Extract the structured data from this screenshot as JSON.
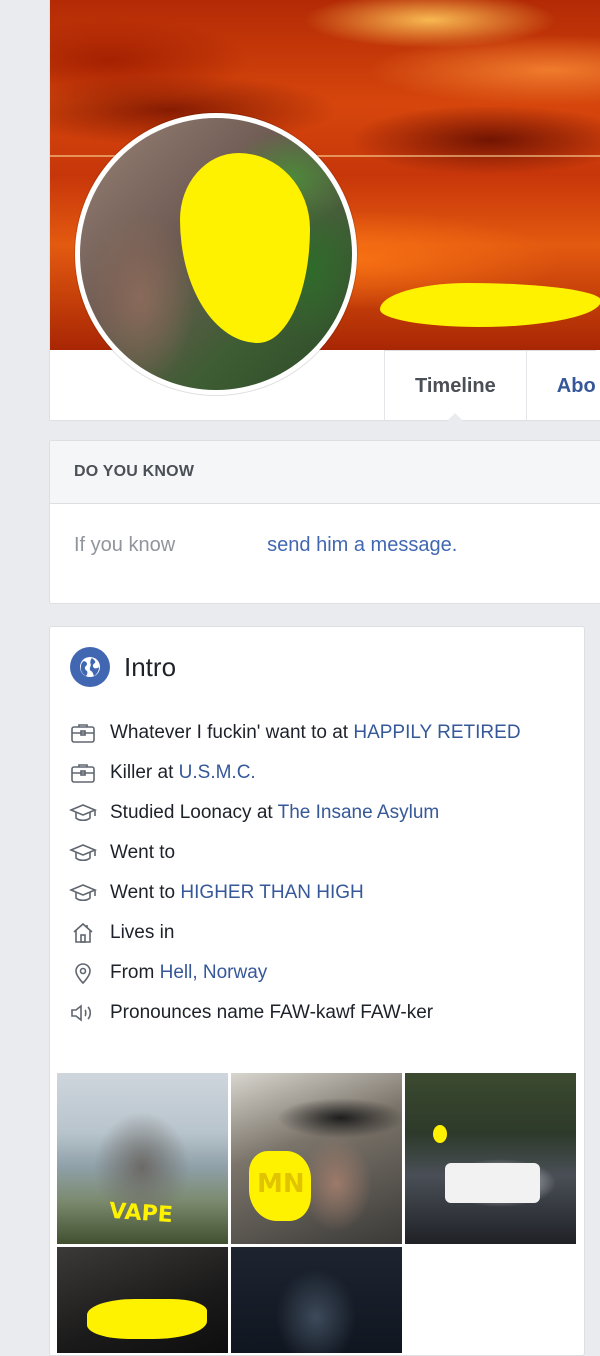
{
  "profile": {
    "tabs": [
      {
        "label": "Timeline"
      },
      {
        "label": "Abo"
      }
    ]
  },
  "do_you_know": {
    "heading": "DO YOU KNOW",
    "text": "If you know",
    "link": "send him a message."
  },
  "intro": {
    "title": "Intro",
    "items": [
      {
        "icon": "briefcase-icon",
        "text": "Whatever I fuckin' want to at",
        "link": "HAPPILY RETIRED"
      },
      {
        "icon": "briefcase-icon",
        "text": "Killer at",
        "link": "U.S.M.C."
      },
      {
        "icon": "graduation-cap-icon",
        "text": "Studied Loonacy at",
        "link": "The Insane Asylum"
      },
      {
        "icon": "graduation-cap-icon",
        "text": "Went to",
        "link": ""
      },
      {
        "icon": "graduation-cap-icon",
        "text": "Went to",
        "link": "HIGHER THAN HIGH"
      },
      {
        "icon": "house-icon",
        "text": "Lives in",
        "link": ""
      },
      {
        "icon": "location-pin-icon",
        "text": "From",
        "link": "Hell, Norway"
      },
      {
        "icon": "speaker-icon",
        "text": "Pronounces name FAW-kawf FAW-ker",
        "link": ""
      }
    ],
    "photo_overlays": {
      "photo1": "VAPE",
      "photo2": "MN"
    }
  },
  "colors": {
    "link": "#365899",
    "background": "#e9ebee",
    "redaction": "#fff200"
  }
}
